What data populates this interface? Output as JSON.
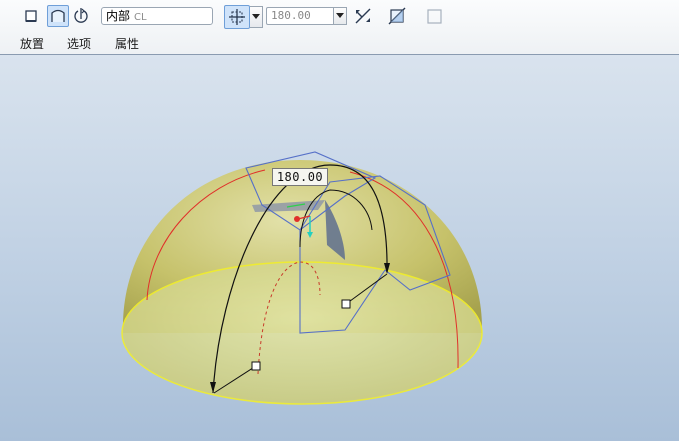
{
  "dashboard": {
    "tools": [
      {
        "icon": "solid-icon"
      },
      {
        "icon": "surface-icon",
        "active": true
      },
      {
        "icon": "flip-icon"
      }
    ],
    "sketch_ref": {
      "value": "内部",
      "placeholder": "CL"
    },
    "depth_option_icon": "blind-depth-icon",
    "angle": {
      "value": "180.00"
    },
    "extra_icons": [
      "flip-direction-icon",
      "remove-material-icon",
      "thicken-icon"
    ],
    "tabs": [
      {
        "label": "放置"
      },
      {
        "label": "选项"
      },
      {
        "label": "属性"
      }
    ]
  },
  "viewport": {
    "dimension_label": "180.00",
    "colors": {
      "background_top": "#d9e3ee",
      "background_bottom": "#a9bfd8",
      "dome": "#c9c25a",
      "dome_edge": "#e8e83a",
      "meridian": "#e0302a",
      "sketch_plane": "#5670c8"
    }
  }
}
